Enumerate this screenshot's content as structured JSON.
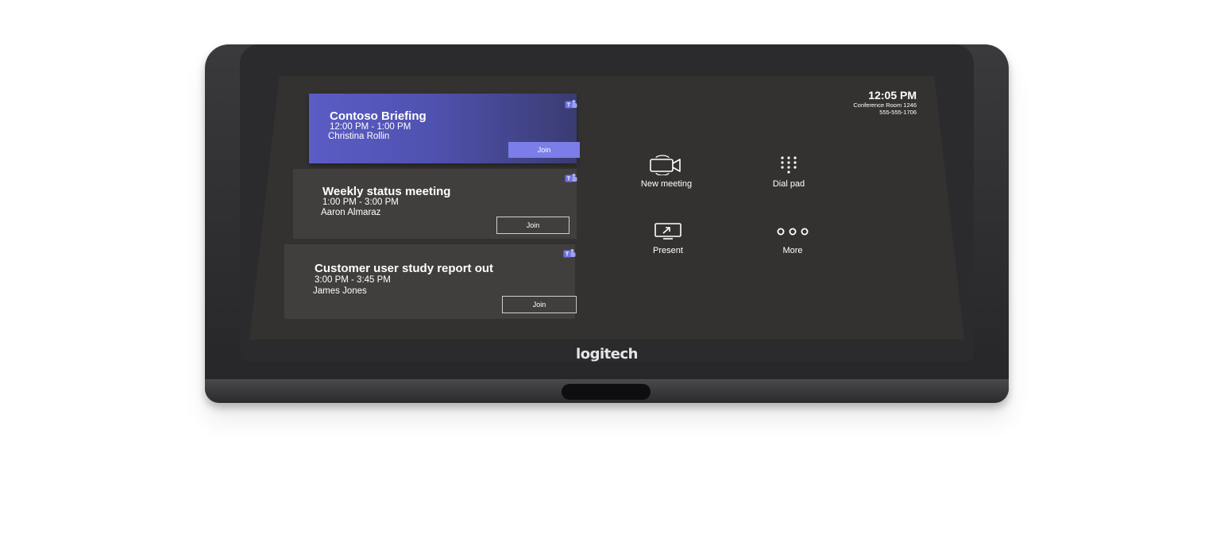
{
  "brand": "logitech",
  "status": {
    "time": "12:05 PM",
    "room": "Conference Room 1246",
    "phone": "555-555-1706"
  },
  "meetings": [
    {
      "title": "Contoso Briefing",
      "time": "12:00 PM - 1:00 PM",
      "host": "Christina Rollin",
      "join_label": "Join",
      "icon": "teams-icon"
    },
    {
      "title": "Weekly status meeting",
      "time": "1:00 PM - 3:00 PM",
      "host": "Aaron Almaraz",
      "join_label": "Join",
      "icon": "teams-icon"
    },
    {
      "title": "Customer user study report out",
      "time": "3:00 PM - 3:45 PM",
      "host": "James Jones",
      "join_label": "Join",
      "icon": "teams-icon"
    }
  ],
  "actions": [
    {
      "label": "New meeting",
      "icon": "video-camera-icon"
    },
    {
      "label": "Dial pad",
      "icon": "dial-pad-icon"
    },
    {
      "label": "Present",
      "icon": "screen-share-icon"
    },
    {
      "label": "More",
      "icon": "more-icon"
    }
  ],
  "colors": {
    "accent": "#5b5cc4",
    "join_primary": "#7b7ee8",
    "screen_bg": "#343231",
    "card_bg": "#413f3e"
  }
}
